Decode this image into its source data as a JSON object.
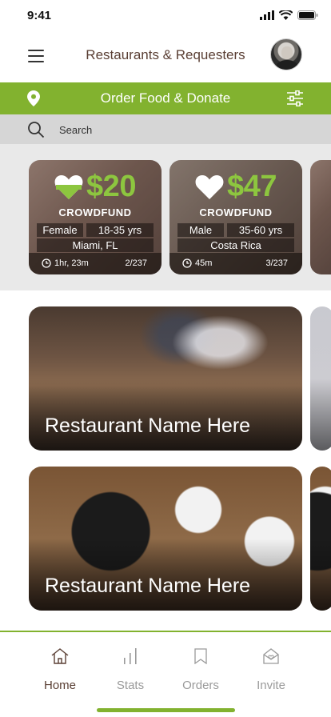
{
  "status_bar": {
    "time": "9:41"
  },
  "header": {
    "title": "Restaurants & Requesters"
  },
  "action_bar": {
    "title": "Order Food & Donate"
  },
  "search": {
    "placeholder": "Search"
  },
  "crowdfunds": [
    {
      "amount": "$20",
      "label": "CROWDFUND",
      "gender": "Female",
      "age": "18-35 yrs",
      "location": "Miami, FL",
      "time": "1hr, 23m",
      "count": "2/237",
      "heart": "filled-green"
    },
    {
      "amount": "$47",
      "label": "CROWDFUND",
      "gender": "Male",
      "age": "35-60 yrs",
      "location": "Costa Rica",
      "time": "45m",
      "count": "3/237",
      "heart": "white"
    }
  ],
  "restaurants": [
    {
      "name": "Restaurant Name Here"
    },
    {
      "name": "Restaurant Name Here"
    }
  ],
  "nav": [
    {
      "label": "Home",
      "icon": "home-icon",
      "active": true
    },
    {
      "label": "Stats",
      "icon": "stats-icon",
      "active": false
    },
    {
      "label": "Orders",
      "icon": "bookmark-icon",
      "active": false
    },
    {
      "label": "Invite",
      "icon": "invite-icon",
      "active": false
    }
  ],
  "colors": {
    "accent": "#82b22f",
    "amount": "#8dc63f",
    "title": "#5a3f34"
  }
}
